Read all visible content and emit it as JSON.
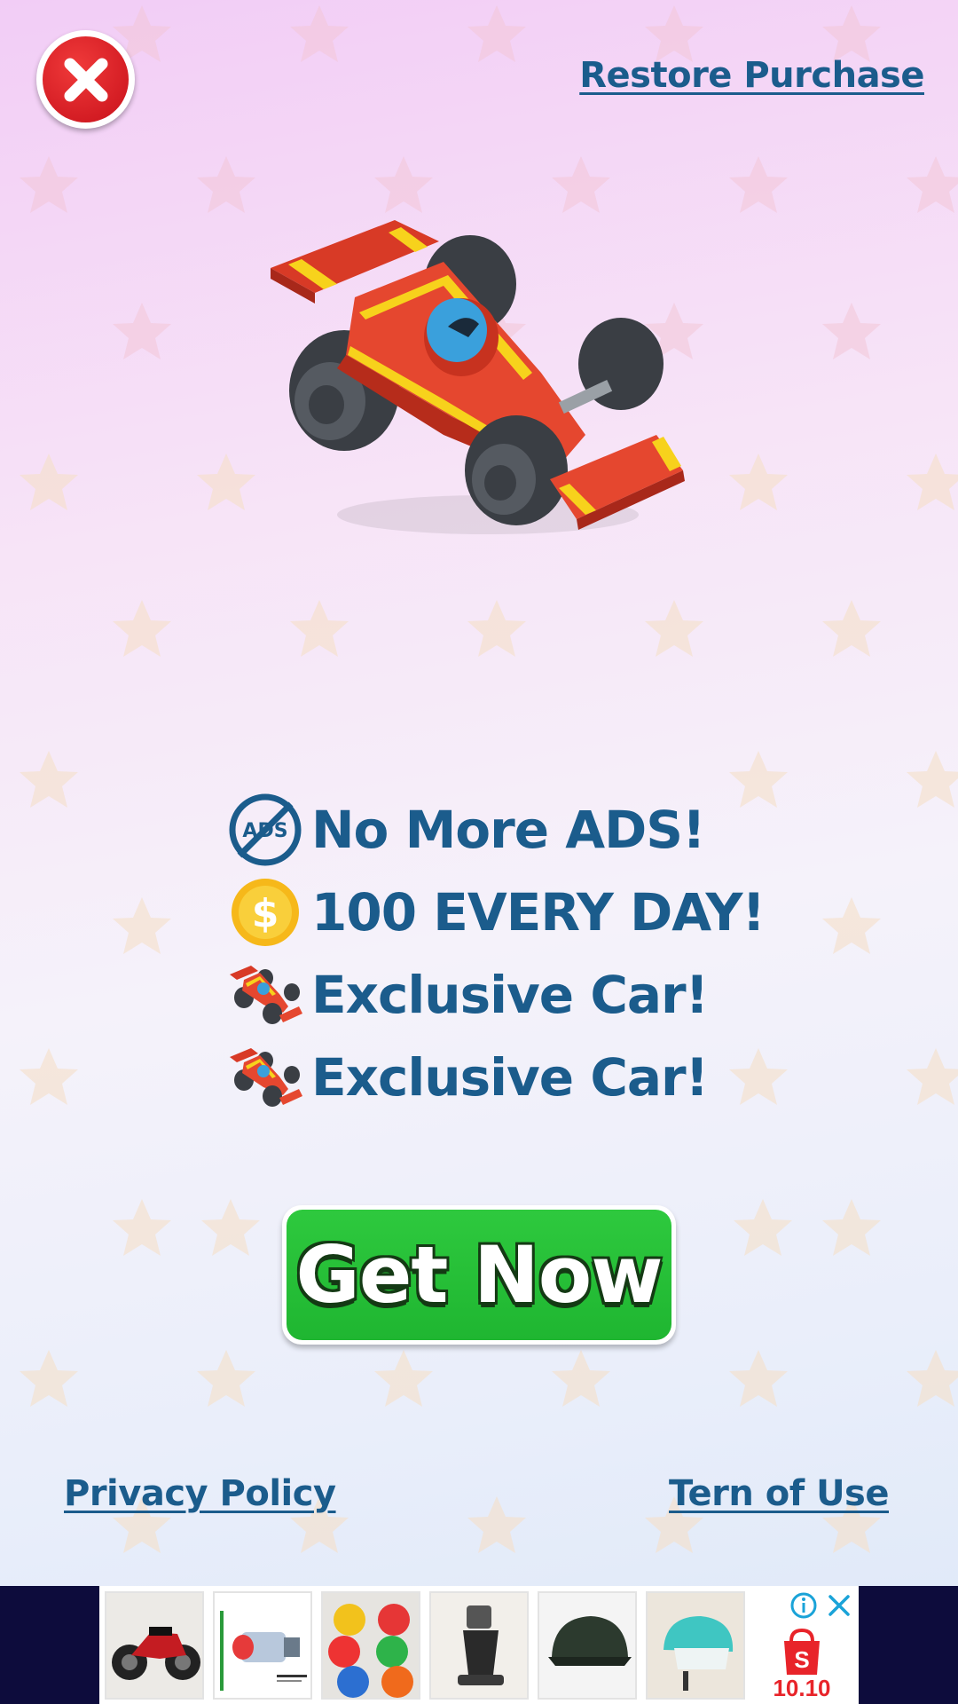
{
  "header": {
    "close_icon": "close-icon",
    "restore_label": "Restore Purchase"
  },
  "hero": {
    "icon": "race-car"
  },
  "features": [
    {
      "icon": "no-ads-icon",
      "label": "No More ADS!",
      "icon_text": "ADS"
    },
    {
      "icon": "coin-icon",
      "label": "100 EVERY DAY!",
      "icon_text": "$"
    },
    {
      "icon": "race-car-icon",
      "label": "Exclusive Car!"
    },
    {
      "icon": "race-car-icon",
      "label": "Exclusive Car!"
    }
  ],
  "cta": {
    "label": "Get Now",
    "color": "#22bd35"
  },
  "footer": {
    "privacy_label": "Privacy Policy",
    "terms_label": "Tern of Use"
  },
  "ad": {
    "items": [
      "motorbike-image",
      "headlight-bulb-image",
      "helmets-image",
      "phone-holder-image",
      "black-helmet-image",
      "kids-helmet-image"
    ],
    "badge_text": "10.10",
    "shop_letter": "S"
  },
  "colors": {
    "text_primary": "#1b5c8c",
    "close_red": "#d41820",
    "ad_background": "#0d0c3c"
  }
}
